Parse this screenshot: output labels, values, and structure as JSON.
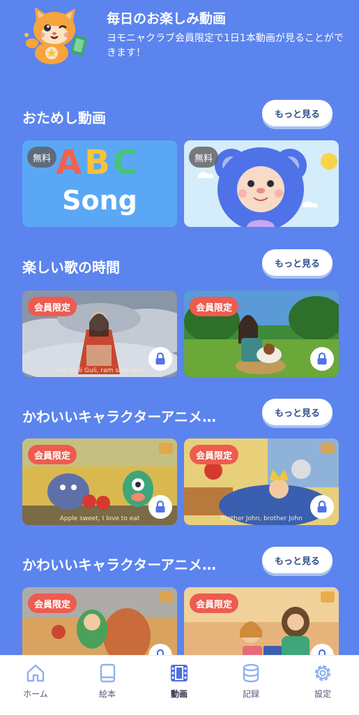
{
  "header": {
    "title": "毎日のお楽しみ動画",
    "description": "ヨモニャクラブ会員限定で1日1本動画が見ることができます！"
  },
  "sections": [
    {
      "title": "おためし動画",
      "more_label": "もっと見る",
      "cards": [
        {
          "badge": "無料",
          "abc": "ABC",
          "song": "Song",
          "locked": false
        },
        {
          "badge": "無料",
          "locked": false
        }
      ]
    },
    {
      "title": "楽しい歌の時間",
      "more_label": "もっと見る",
      "cards": [
        {
          "badge": "会員限定",
          "caption": "Guli Guli Guli, ram sam sam",
          "locked": true
        },
        {
          "badge": "会員限定",
          "caption": "",
          "locked": true
        }
      ]
    },
    {
      "title": "かわいいキャラクターアニメ…",
      "more_label": "もっと見る",
      "cards": [
        {
          "badge": "会員限定",
          "caption": "Apple sweet, I love to eat",
          "locked": true
        },
        {
          "badge": "会員限定",
          "caption": "Brother John, brother John",
          "locked": true
        }
      ]
    },
    {
      "title": "かわいいキャラクターアニメ…",
      "more_label": "もっと見る",
      "cards": [
        {
          "badge": "会員限定",
          "caption": "",
          "locked": true
        },
        {
          "badge": "会員限定",
          "caption": "",
          "locked": true
        }
      ]
    }
  ],
  "tabbar": {
    "items": [
      {
        "label": "ホーム",
        "icon": "home-icon",
        "active": false
      },
      {
        "label": "絵本",
        "icon": "book-icon",
        "active": false
      },
      {
        "label": "動画",
        "icon": "film-icon",
        "active": true
      },
      {
        "label": "記録",
        "icon": "database-icon",
        "active": false
      },
      {
        "label": "設定",
        "icon": "gear-icon",
        "active": false
      }
    ]
  },
  "colors": {
    "background": "#5b84ee",
    "member_badge": "#ee5b4f",
    "tab_icon_active": "#4f6fe0",
    "tab_icon_inactive": "#8fb0f0"
  }
}
